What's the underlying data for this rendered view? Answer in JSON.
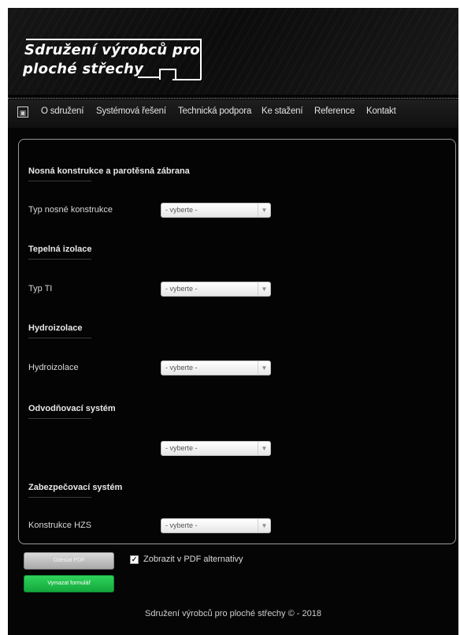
{
  "logo": {
    "line1": "Sdružení výrobců pro",
    "line2": "ploché střechy"
  },
  "nav": {
    "icon": "pdf-document-icon",
    "items": [
      "O sdružení",
      "Systémová řešení",
      "Technická podpora",
      "Ke stažení",
      "Reference",
      "Kontakt"
    ]
  },
  "form": {
    "sections": [
      {
        "title": "Nosná konstrukce a parotěsná zábrana",
        "field_label": "Typ nosné konstrukce",
        "select_value": "- vyberte -"
      },
      {
        "title": "Tepelná izolace",
        "field_label": "Typ TI",
        "select_value": "- vyberte -"
      },
      {
        "title": "Hydroizolace",
        "field_label": "Hydroizolace",
        "select_value": "- vyberte -"
      },
      {
        "title": "Odvodňovací systém",
        "field_label": "",
        "select_value": "- vyberte -"
      },
      {
        "title": "Zabezpečovací systém",
        "field_label": "Konstrukce HZS",
        "select_value": "- vyberte -"
      }
    ]
  },
  "actions": {
    "pdf_button": "Odeslat PDF",
    "checkbox_checked": true,
    "checkbox_label": "Zobrazit v PDF alternativy",
    "reset_button": "Vymazat formulář"
  },
  "footer": {
    "text": "Sdružení výrobců pro ploché střechy © - 2018"
  },
  "colors": {
    "background": "#050505",
    "reset_button": "#1fbf4a",
    "pdf_button": "#bdbdbd"
  }
}
